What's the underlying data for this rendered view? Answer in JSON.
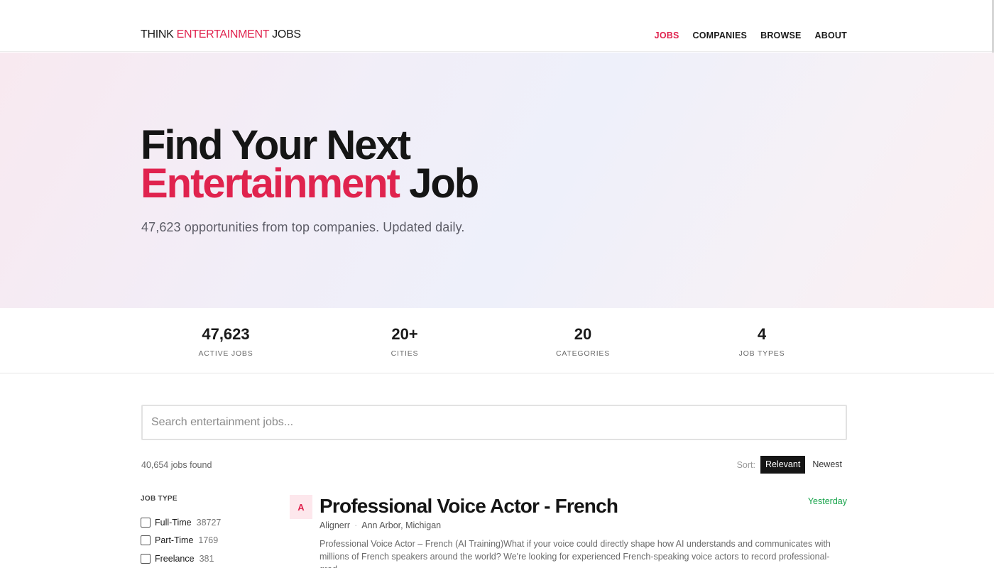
{
  "header": {
    "logo": {
      "part1": "THINK ",
      "part2": "ENTERTAINMENT",
      "part3": " JOBS"
    },
    "nav": [
      {
        "label": "JOBS",
        "active": true
      },
      {
        "label": "COMPANIES",
        "active": false
      },
      {
        "label": "BROWSE",
        "active": false
      },
      {
        "label": "ABOUT",
        "active": false
      }
    ]
  },
  "hero": {
    "line1": "Find Your Next",
    "line2_accent": "Entertainment",
    "line2_rest": " Job",
    "subtitle": "47,623 opportunities from top companies. Updated daily."
  },
  "stats": [
    {
      "value": "47,623",
      "label": "ACTIVE JOBS"
    },
    {
      "value": "20+",
      "label": "CITIES"
    },
    {
      "value": "20",
      "label": "CATEGORIES"
    },
    {
      "value": "4",
      "label": "JOB TYPES"
    }
  ],
  "search": {
    "placeholder": "Search entertainment jobs...",
    "value": ""
  },
  "results": {
    "count_text": "40,654 jobs found"
  },
  "sort": {
    "label": "Sort:",
    "options": [
      "Relevant",
      "Newest"
    ],
    "selected": "Relevant"
  },
  "filters": {
    "heading": "JOB TYPE",
    "items": [
      {
        "name": "Full-Time",
        "count": "38727"
      },
      {
        "name": "Part-Time",
        "count": "1769"
      },
      {
        "name": "Freelance",
        "count": "381"
      }
    ]
  },
  "jobs": [
    {
      "avatar_letter": "A",
      "title": "Professional Voice Actor - French",
      "company": "Alignerr",
      "location": "Ann Arbor, Michigan",
      "posted": "Yesterday",
      "description": "Professional Voice Actor – French (AI Training)What if your voice could directly shape how AI understands and communicates with millions of French speakers around the world? We're looking for experienced French-speaking voice actors to record professional-grad..."
    }
  ],
  "colors": {
    "accent": "#e0234e",
    "date_green": "#16a34a",
    "dark": "#151515"
  }
}
